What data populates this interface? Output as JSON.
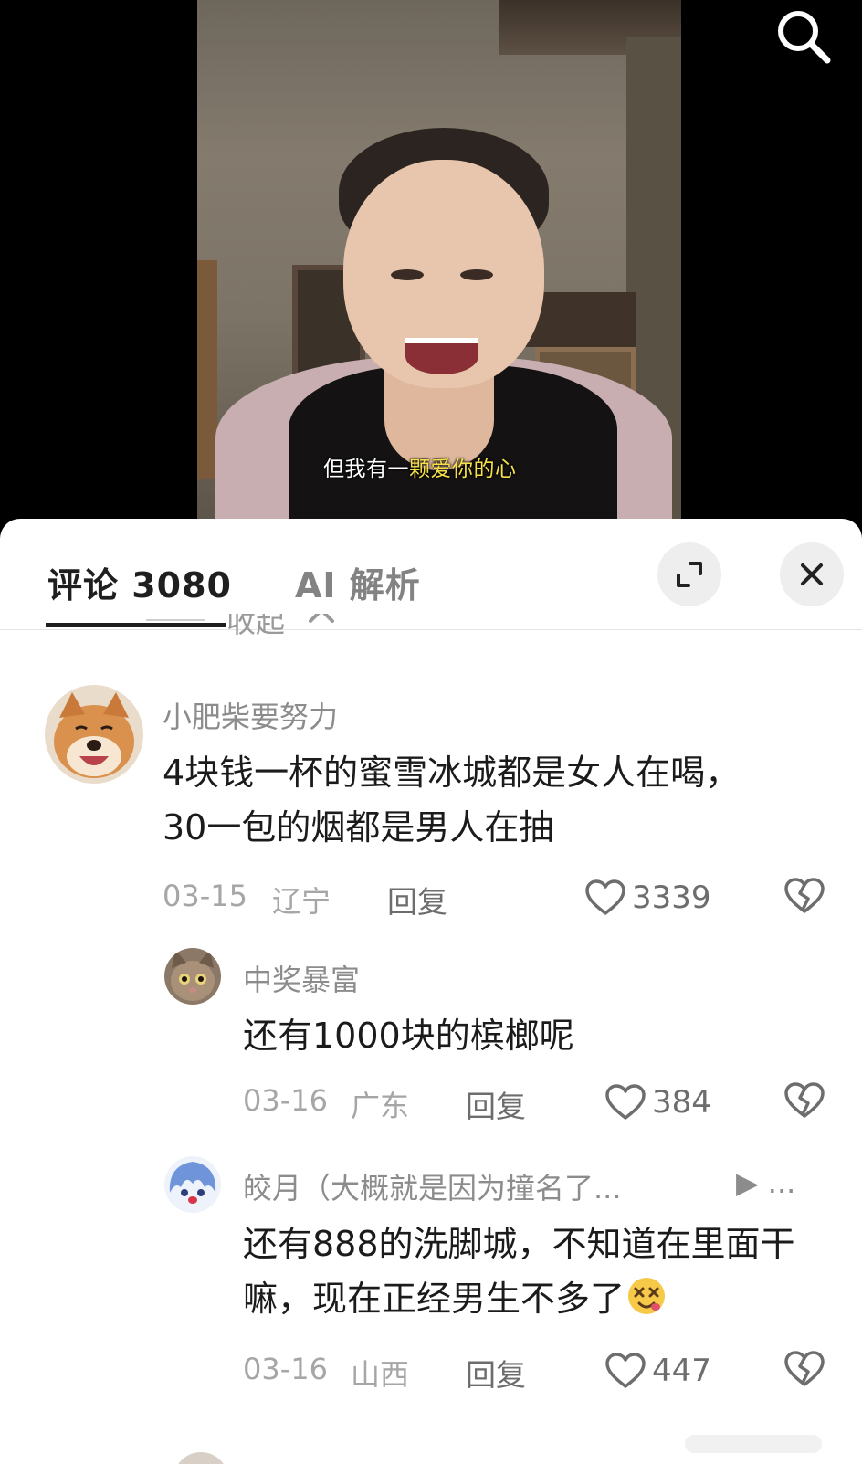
{
  "video": {
    "subtitle_prefix": "但我有一",
    "subtitle_highlight": "颗爱你的心"
  },
  "header": {
    "icons": {
      "search": "search-icon",
      "expand": "expand-icon",
      "close": "close-icon"
    }
  },
  "tabs": {
    "comments_label": "评论 3080",
    "ai_label": "AI 解析"
  },
  "collapse": {
    "label": "收起"
  },
  "comments": [
    {
      "username": "小肥柴要努力",
      "text": "4块钱一杯的蜜雪冰城都是女人在喝，30一包的烟都是男人在抽",
      "date": "03-15",
      "location": "辽宁",
      "reply_label": "回复",
      "likes": "3339"
    },
    {
      "username": "中奖暴富",
      "text": "还有1000块的槟榔呢",
      "date": "03-16",
      "location": "广东",
      "reply_label": "回复",
      "likes": "384"
    },
    {
      "username": "皎月（大概就是因为撞名了...",
      "reply_to_marker": "▶ ...",
      "text": "还有888的洗脚城，不知道在里面干嘛，现在正经男生不多了",
      "emoji": "dizzy-face-emoji",
      "date": "03-16",
      "location": "山西",
      "reply_label": "回复",
      "likes": "447"
    }
  ],
  "colors": {
    "highlight_subtitle": "#f7e14b",
    "text_primary": "#1b1b1b",
    "text_secondary": "#8c8c8c",
    "panel_bg": "#ffffff"
  }
}
